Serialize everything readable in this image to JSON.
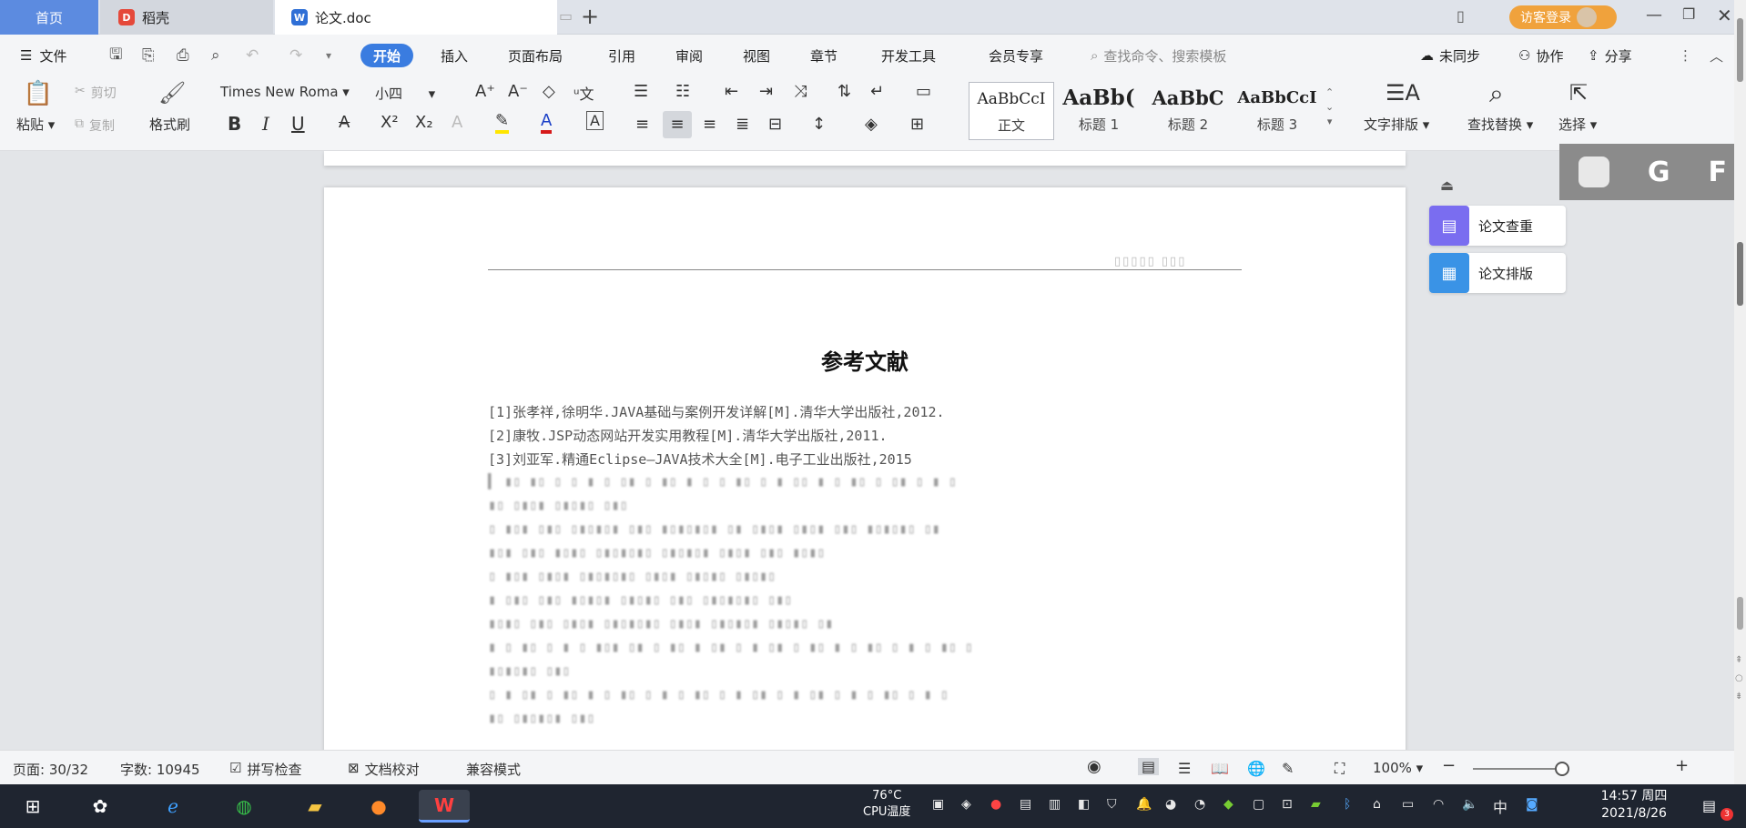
{
  "tabs": {
    "home": "首页",
    "daoke": "稻壳",
    "doc": "论文.doc",
    "new_tab": "+"
  },
  "titlebar": {
    "login_label": "访客登录"
  },
  "menu": {
    "file": "文件",
    "start": "开始",
    "insert": "插入",
    "layout": "页面布局",
    "reference": "引用",
    "review": "审阅",
    "view": "视图",
    "section": "章节",
    "dev": "开发工具",
    "member": "会员专享",
    "search_placeholder": "查找命令、搜索模板",
    "unsynced": "未同步",
    "collab": "协作",
    "share": "分享"
  },
  "ribbon": {
    "paste": "粘贴",
    "cut": "剪切",
    "copy": "复制",
    "format_painter": "格式刷",
    "font_name": "Times New Roma",
    "font_size": "小四",
    "styles": [
      {
        "sample": "AaBbCcI",
        "name": "正文"
      },
      {
        "sample": "AaBb(",
        "name": "标题 1"
      },
      {
        "sample": "AaBbC",
        "name": "标题 2"
      },
      {
        "sample": "AaBbCcI",
        "name": "标题 3"
      }
    ],
    "text_layout": "文字排版",
    "find_replace": "查找替换",
    "select": "选择"
  },
  "document": {
    "title": "参考文献",
    "references": [
      "[1]张孝祥,徐明华.JAVA基础与案例开发详解[M].清华大学出版社,2012.",
      "[2]康牧.JSP动态网站开发实用教程[M].清华大学出版社,2011.",
      "[3]刘亚军.精通Eclipse—JAVA技术大全[M].电子工业出版社,2015"
    ]
  },
  "side_panel": {
    "check": "论文查重",
    "format": "论文排版"
  },
  "overlay": {
    "g": "G",
    "f": "F"
  },
  "status": {
    "page": "页面: 30/32",
    "words": "字数: 10945",
    "spell": "拼写检查",
    "proof": "文档校对",
    "compat": "兼容模式",
    "zoom": "100%"
  },
  "taskbar": {
    "temp": "76°C",
    "cpu": "CPU温度",
    "ime": "中",
    "time": "14:57 周四",
    "date": "2021/8/26",
    "notif_count": "3"
  }
}
